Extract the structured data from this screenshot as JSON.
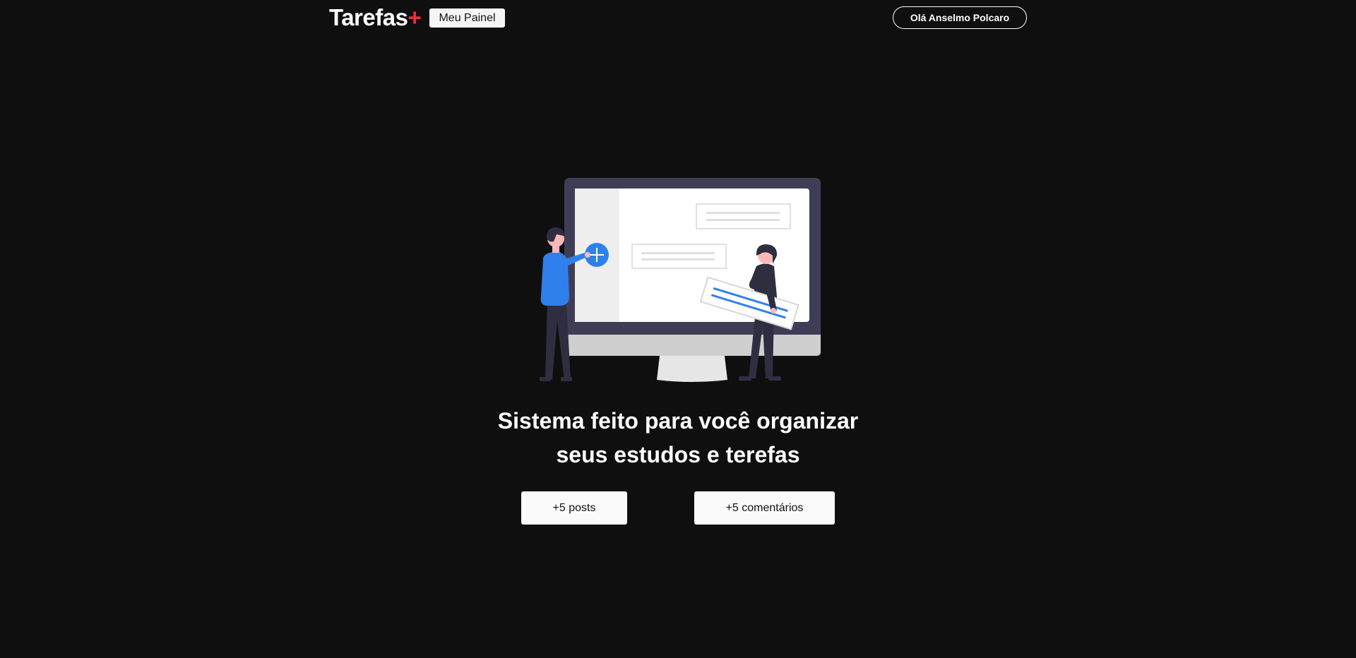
{
  "header": {
    "logo_text": "Tarefas",
    "logo_plus": "+",
    "panel_button": "Meu Painel",
    "user_button": "Olá Anselmo Polcaro"
  },
  "hero": {
    "title_line1": "Sistema feito para você organizar",
    "title_line2": "seus estudos e terefas"
  },
  "stats": {
    "posts": "+5 posts",
    "comments": "+5 comentários"
  },
  "colors": {
    "background": "#0f0f0f",
    "accent": "#ea3140",
    "illustration_blue": "#2f80ed",
    "illustration_dark": "#3f3d56"
  }
}
